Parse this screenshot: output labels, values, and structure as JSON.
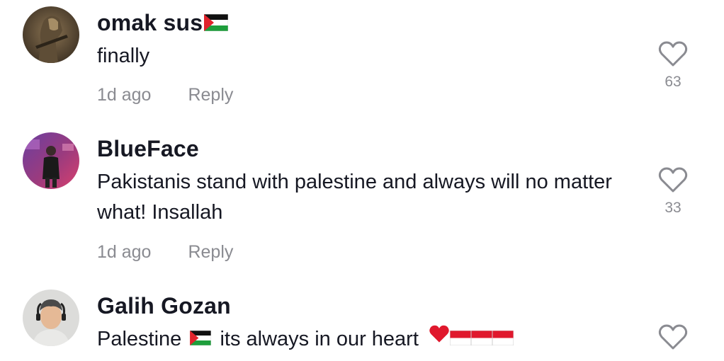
{
  "comments": [
    {
      "username": "omak sus",
      "username_emoji": "palestine-flag",
      "text_parts": [
        "finally"
      ],
      "time": "1d ago",
      "reply_label": "Reply",
      "likes": "63"
    },
    {
      "username": "BlueFace",
      "text_parts": [
        "Pakistanis stand with palestine and always will no matter what! Insallah"
      ],
      "time": "1d ago",
      "reply_label": "Reply",
      "likes": "33"
    },
    {
      "username": "Galih Gozan",
      "text_parts": [
        "Palestine",
        "its always in our heart"
      ],
      "text_emojis": [
        "palestine-flag",
        "red-heart",
        "indonesia-flag",
        "indonesia-flag",
        "indonesia-flag"
      ]
    }
  ],
  "colors": {
    "primary_text": "#161823",
    "secondary_text": "#8a8b91",
    "heart_outline": "#8a8b91",
    "background": "#ffffff"
  }
}
